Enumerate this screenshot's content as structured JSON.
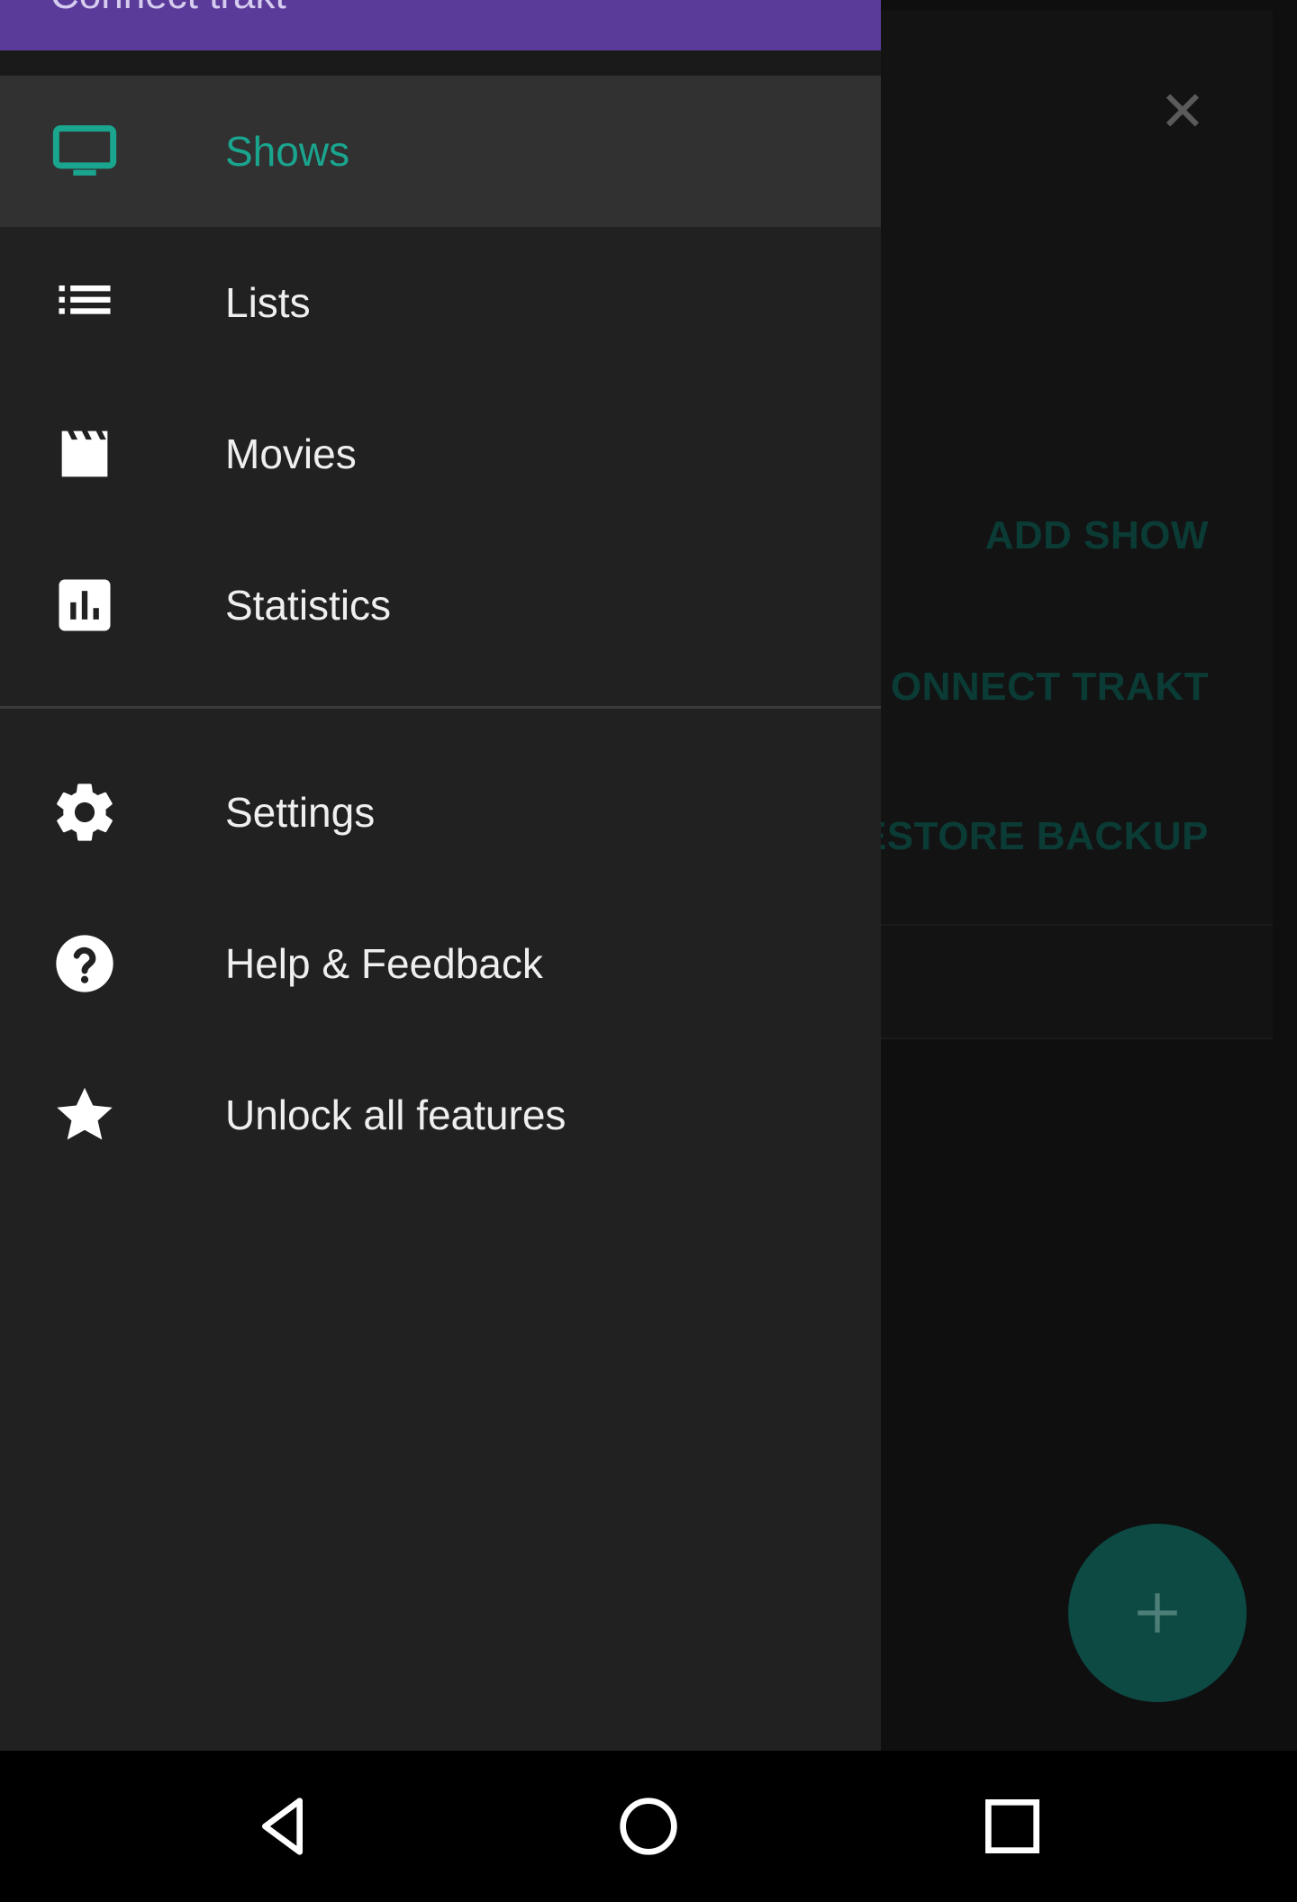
{
  "drawer": {
    "header_text": "Connect trakt",
    "selected_color": "#1aa58f",
    "items": [
      {
        "label": "Shows",
        "icon": "tv-icon",
        "selected": true
      },
      {
        "label": "Lists",
        "icon": "list-icon",
        "selected": false
      },
      {
        "label": "Movies",
        "icon": "movie-clapper-icon",
        "selected": false
      },
      {
        "label": "Statistics",
        "icon": "bar-chart-icon",
        "selected": false
      },
      {
        "label": "Settings",
        "icon": "gear-icon",
        "selected": false
      },
      {
        "label": "Help & Feedback",
        "icon": "help-icon",
        "selected": false
      },
      {
        "label": "Unlock all features",
        "icon": "star-icon",
        "selected": false
      }
    ]
  },
  "background": {
    "actions": [
      "ADD SHOW",
      "ONNECT TRAKT",
      "ESTORE BACKUP"
    ],
    "close_icon": "close-icon",
    "fab_icon": "plus-icon"
  },
  "system_nav": {
    "buttons": [
      "back-icon",
      "home-icon",
      "recents-icon"
    ]
  }
}
